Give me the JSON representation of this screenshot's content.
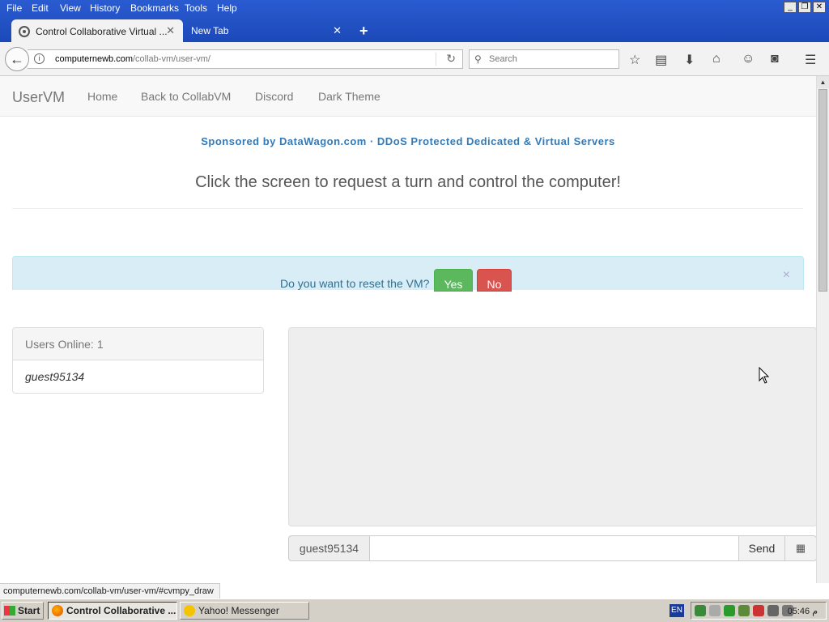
{
  "browser": {
    "menu": [
      "File",
      "Edit",
      "View",
      "History",
      "Bookmarks",
      "Tools",
      "Help"
    ],
    "tabs": [
      {
        "title": "Control Collaborative Virtual ..."
      },
      {
        "title": "New Tab"
      }
    ],
    "url_host": "computernewb.com",
    "url_path": "/collab-vm/user-vm/",
    "search_placeholder": "Search",
    "status_url": "computernewb.com/collab-vm/user-vm/#cvmpy_draw"
  },
  "site": {
    "brand": "UserVM",
    "nav": [
      "Home",
      "Back to CollabVM",
      "Discord",
      "Dark Theme"
    ],
    "sponsor": "Sponsored by DataWagon.com · DDoS Protected Dedicated & Virtual Servers",
    "instruction": "Click the screen to request a turn and control the computer!",
    "reset_prompt": {
      "question": "Do you want to reset the VM?",
      "yes": "Yes",
      "no": "No"
    },
    "users": {
      "heading": "Users Online:",
      "count": "1",
      "list": [
        "guest95134"
      ]
    },
    "chat": {
      "username": "guest95134",
      "input_value": "",
      "send_label": "Send"
    }
  },
  "taskbar": {
    "start": "Start",
    "tasks": [
      "Control Collaborative ...",
      "Yahoo! Messenger"
    ],
    "lang": "EN",
    "clock": "05:46 م"
  },
  "colors": {
    "brand_blue": "#337ab7",
    "alert_bg": "#d9edf7",
    "yes_green": "#5cb85c",
    "no_red": "#d9534f"
  }
}
